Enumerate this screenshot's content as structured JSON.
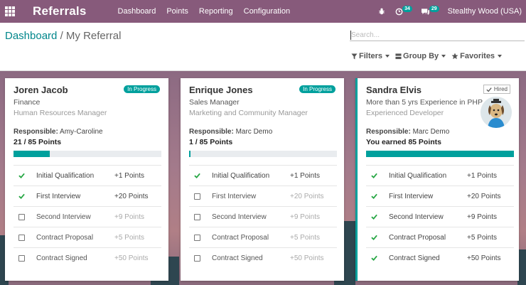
{
  "app": {
    "title": "Referrals",
    "menu": [
      "Dashboard",
      "Points",
      "Reporting",
      "Configuration"
    ],
    "chat_badge": "34",
    "messages_badge": "29",
    "company": "Stealthy Wood (USA)"
  },
  "breadcrumb": {
    "parent": "Dashboard",
    "separator": "/",
    "current": "My Referral"
  },
  "search": {
    "placeholder": "Search..."
  },
  "filters": {
    "filters": "Filters",
    "group_by": "Group By",
    "favorites": "Favorites"
  },
  "cards": [
    {
      "name": "Joren Jacob",
      "badge": "In Progress",
      "line1": "Finance",
      "line2": "Human Resources Manager",
      "responsible_label": "Responsible:",
      "responsible": "Amy-Caroline",
      "points_text": "21 / 85 Points",
      "progress": 0.247,
      "stages": [
        {
          "name": "Initial Qualification",
          "points": "+1 Points",
          "done": true
        },
        {
          "name": "First Interview",
          "points": "+20 Points",
          "done": true
        },
        {
          "name": "Second Interview",
          "points": "+9 Points",
          "done": false
        },
        {
          "name": "Contract Proposal",
          "points": "+5 Points",
          "done": false
        },
        {
          "name": "Contract Signed",
          "points": "+50 Points",
          "done": false
        }
      ]
    },
    {
      "name": "Enrique Jones",
      "badge": "In Progress",
      "line1": "Sales Manager",
      "line2": "Marketing and Community Manager",
      "responsible_label": "Responsible:",
      "responsible": "Marc Demo",
      "points_text": "1 / 85 Points",
      "progress": 0.012,
      "stages": [
        {
          "name": "Initial Qualification",
          "points": "+1 Points",
          "done": true
        },
        {
          "name": "First Interview",
          "points": "+20 Points",
          "done": false
        },
        {
          "name": "Second Interview",
          "points": "+9 Points",
          "done": false
        },
        {
          "name": "Contract Proposal",
          "points": "+5 Points",
          "done": false
        },
        {
          "name": "Contract Signed",
          "points": "+50 Points",
          "done": false
        }
      ]
    },
    {
      "name": "Sandra Elvis",
      "badge": "Hired",
      "line1": "More than 5 yrs Experience in PHP",
      "line2": "Experienced Developer",
      "responsible_label": "Responsible:",
      "responsible": "Marc Demo",
      "points_text": "You earned 85 Points",
      "progress": 1.0,
      "stages": [
        {
          "name": "Initial Qualification",
          "points": "+1 Points",
          "done": true
        },
        {
          "name": "First Interview",
          "points": "+20 Points",
          "done": true
        },
        {
          "name": "Second Interview",
          "points": "+9 Points",
          "done": true
        },
        {
          "name": "Contract Proposal",
          "points": "+5 Points",
          "done": true
        },
        {
          "name": "Contract Signed",
          "points": "+50 Points",
          "done": true
        }
      ]
    }
  ],
  "colors": {
    "navbar": "#875a7b",
    "accent": "#00a09d",
    "link": "#00868b"
  }
}
